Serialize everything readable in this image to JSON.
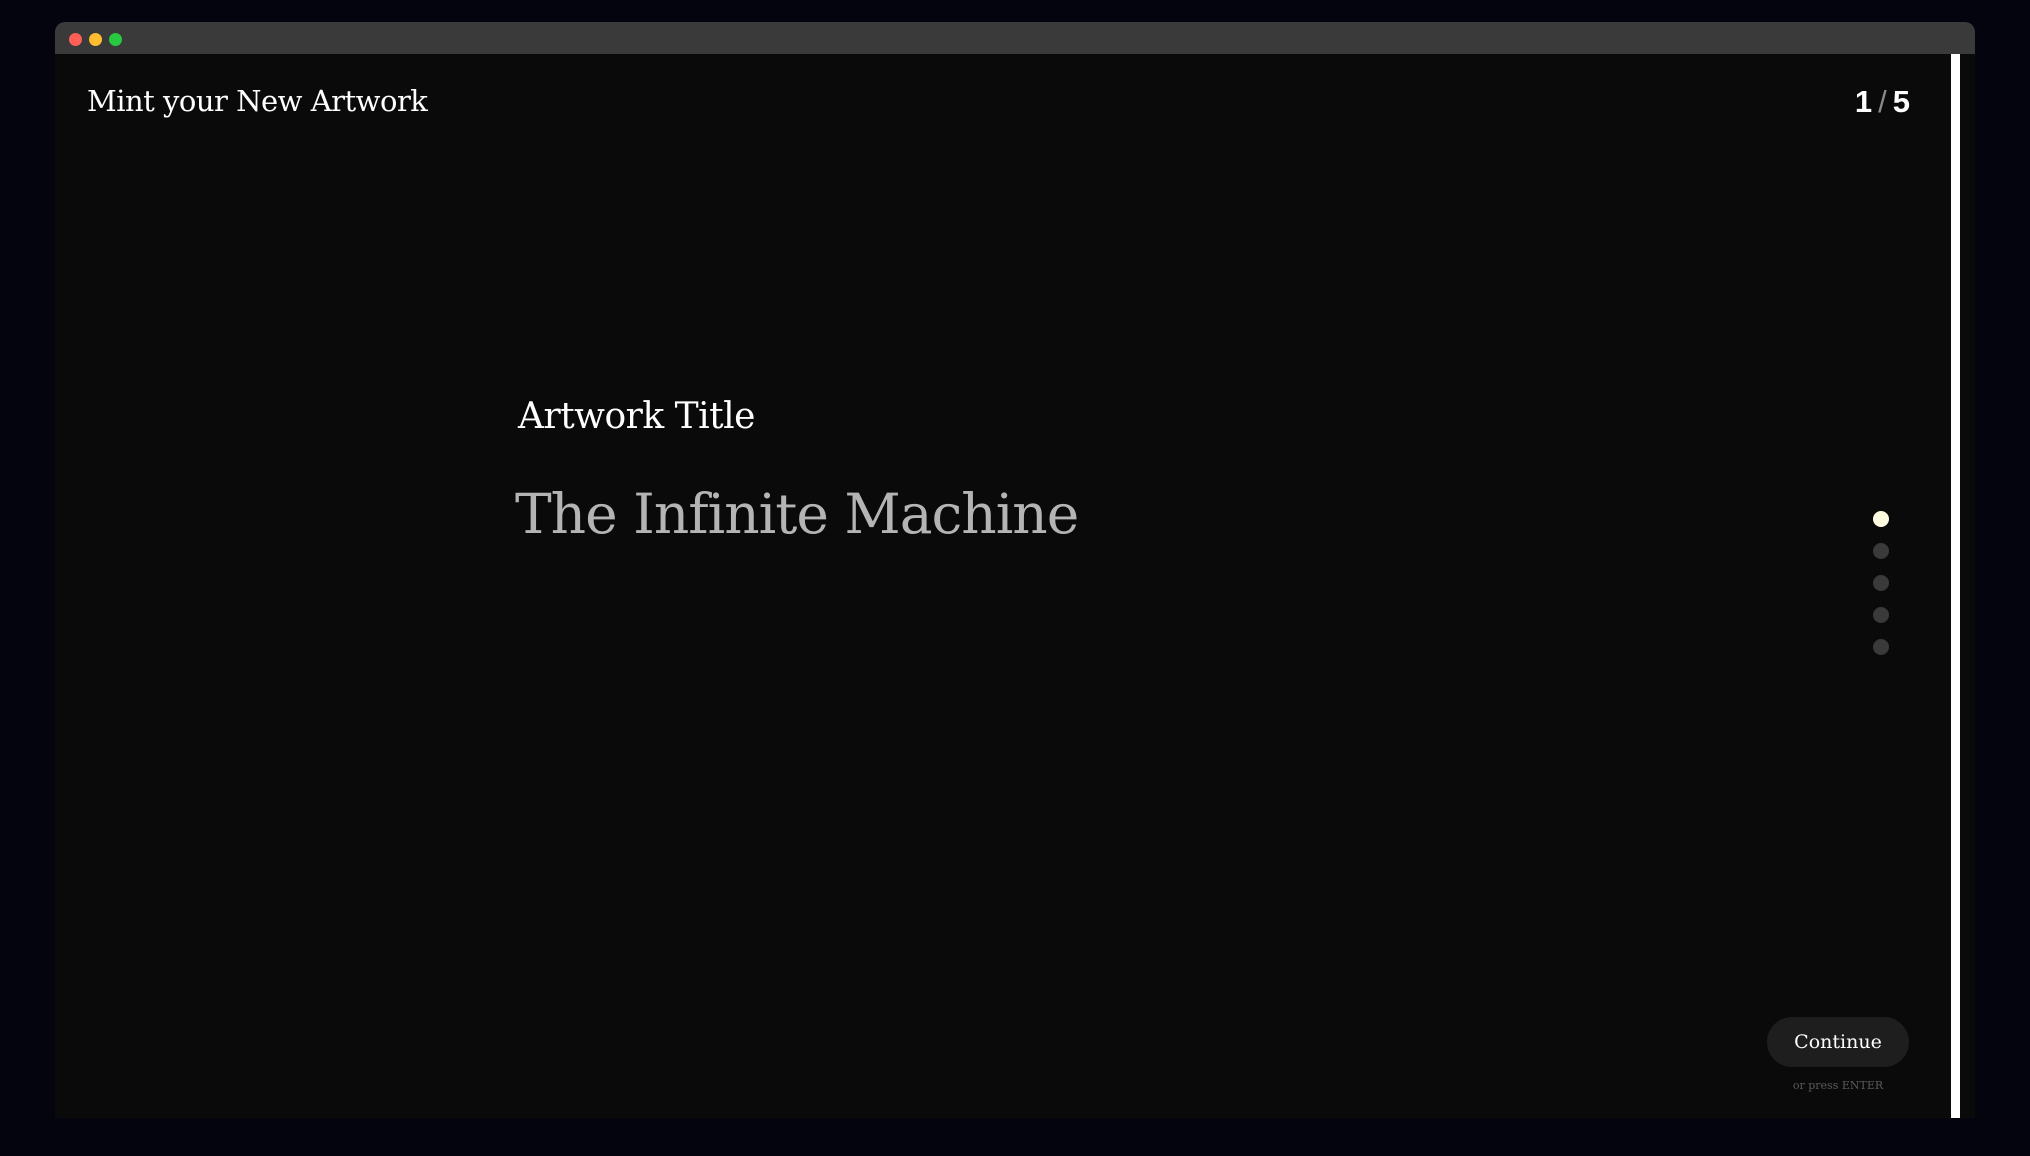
{
  "window": {
    "controls": [
      "close",
      "minimize",
      "maximize"
    ]
  },
  "header": {
    "title": "Mint your New Artwork",
    "step_current": "1",
    "step_separator": "/",
    "step_total": "5"
  },
  "form": {
    "field_label": "Artwork Title",
    "field_value": "The Infinite Machine"
  },
  "progress": {
    "total_steps": 5,
    "active_step": 1
  },
  "footer": {
    "continue_label": "Continue",
    "enter_hint": "or press ENTER"
  },
  "colors": {
    "background": "#0a0a0a",
    "outer_background": "#04040f",
    "active_dot": "#fffbe0",
    "inactive_dot": "#3a3a3a",
    "input_text": "#b4b4b4",
    "button_bg": "#1e1e1e"
  }
}
